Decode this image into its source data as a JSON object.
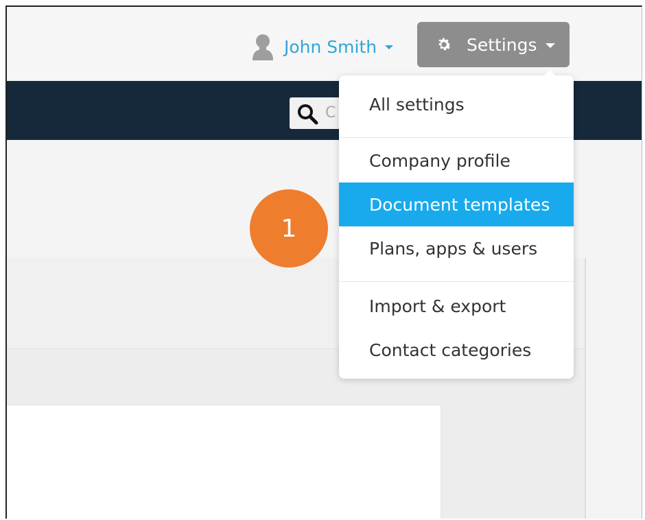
{
  "header": {
    "user": {
      "name": "John Smith",
      "icon": "user-avatar-icon"
    },
    "settings": {
      "label": "Settings",
      "icon": "gear-icon"
    }
  },
  "navbar": {
    "search_icon": "search-icon",
    "search_placeholder": "C"
  },
  "settings_menu": {
    "items": [
      {
        "label": "All settings"
      },
      {
        "label": "Company profile"
      },
      {
        "label": "Document templates",
        "active": true
      },
      {
        "label": "Plans, apps & users"
      },
      {
        "label": "Import & export"
      },
      {
        "label": "Contact categories"
      }
    ]
  },
  "step_badge": {
    "number": "1",
    "color": "#ef7d2e"
  },
  "colors": {
    "accent": "#18aaec",
    "link": "#2ea6dc",
    "navbar": "#15293a",
    "settings_button": "#8d8d8d"
  }
}
